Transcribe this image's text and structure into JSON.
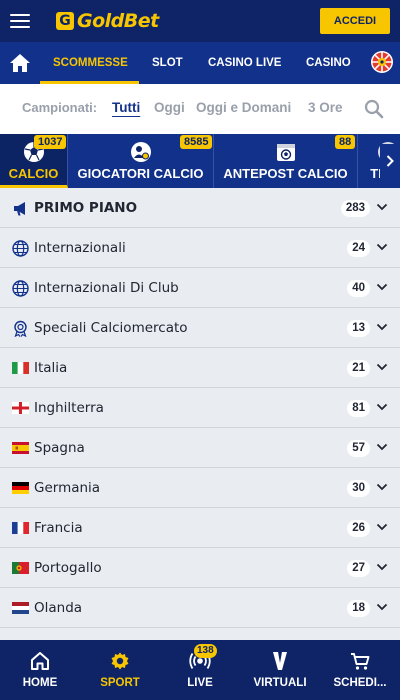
{
  "header": {
    "logo_text": "GoldBet",
    "login_label": "ACCEDI"
  },
  "nav": {
    "items": [
      {
        "label": "SCOMMESSE",
        "active": true
      },
      {
        "label": "SLOT"
      },
      {
        "label": "CASINO LIVE"
      },
      {
        "label": "CASINO"
      }
    ]
  },
  "filters": {
    "label": "Campionati:",
    "options": [
      "Tutti",
      "Oggi",
      "Oggi e Domani",
      "3 Ore"
    ],
    "selected": "Tutti"
  },
  "sports": [
    {
      "label": "CALCIO",
      "count": "1037",
      "active": true
    },
    {
      "label": "GIOCATORI CALCIO",
      "count": "8585"
    },
    {
      "label": "ANTEPOST CALCIO",
      "count": "88"
    },
    {
      "label": "TENN"
    }
  ],
  "leagues": [
    {
      "label": "PRIMO PIANO",
      "count": "283",
      "icon": "megaphone-icon"
    },
    {
      "label": "Internazionali",
      "count": "24",
      "icon": "globe-icon"
    },
    {
      "label": "Internazionali Di Club",
      "count": "40",
      "icon": "globe-icon"
    },
    {
      "label": "Speciali Calciomercato",
      "count": "13",
      "icon": "medal-icon"
    },
    {
      "label": "Italia",
      "count": "21",
      "icon": "flag-italy"
    },
    {
      "label": "Inghilterra",
      "count": "81",
      "icon": "flag-england"
    },
    {
      "label": "Spagna",
      "count": "57",
      "icon": "flag-spain"
    },
    {
      "label": "Germania",
      "count": "30",
      "icon": "flag-germany"
    },
    {
      "label": "Francia",
      "count": "26",
      "icon": "flag-france"
    },
    {
      "label": "Portogallo",
      "count": "27",
      "icon": "flag-portugal"
    },
    {
      "label": "Olanda",
      "count": "18",
      "icon": "flag-netherlands"
    }
  ],
  "bottom_nav": {
    "items": [
      {
        "label": "HOME",
        "icon": "home-icon"
      },
      {
        "label": "SPORT",
        "icon": "gear-icon",
        "active": true
      },
      {
        "label": "LIVE",
        "icon": "live-icon",
        "badge": "138"
      },
      {
        "label": "VIRTUALI",
        "icon": "virtual-icon"
      },
      {
        "label": "SCHEDI...",
        "icon": "cart-icon"
      }
    ]
  },
  "colors": {
    "navy": "#0e2466",
    "blue": "#11318a",
    "gold": "#f7c600",
    "background": "#e9ecf1"
  }
}
